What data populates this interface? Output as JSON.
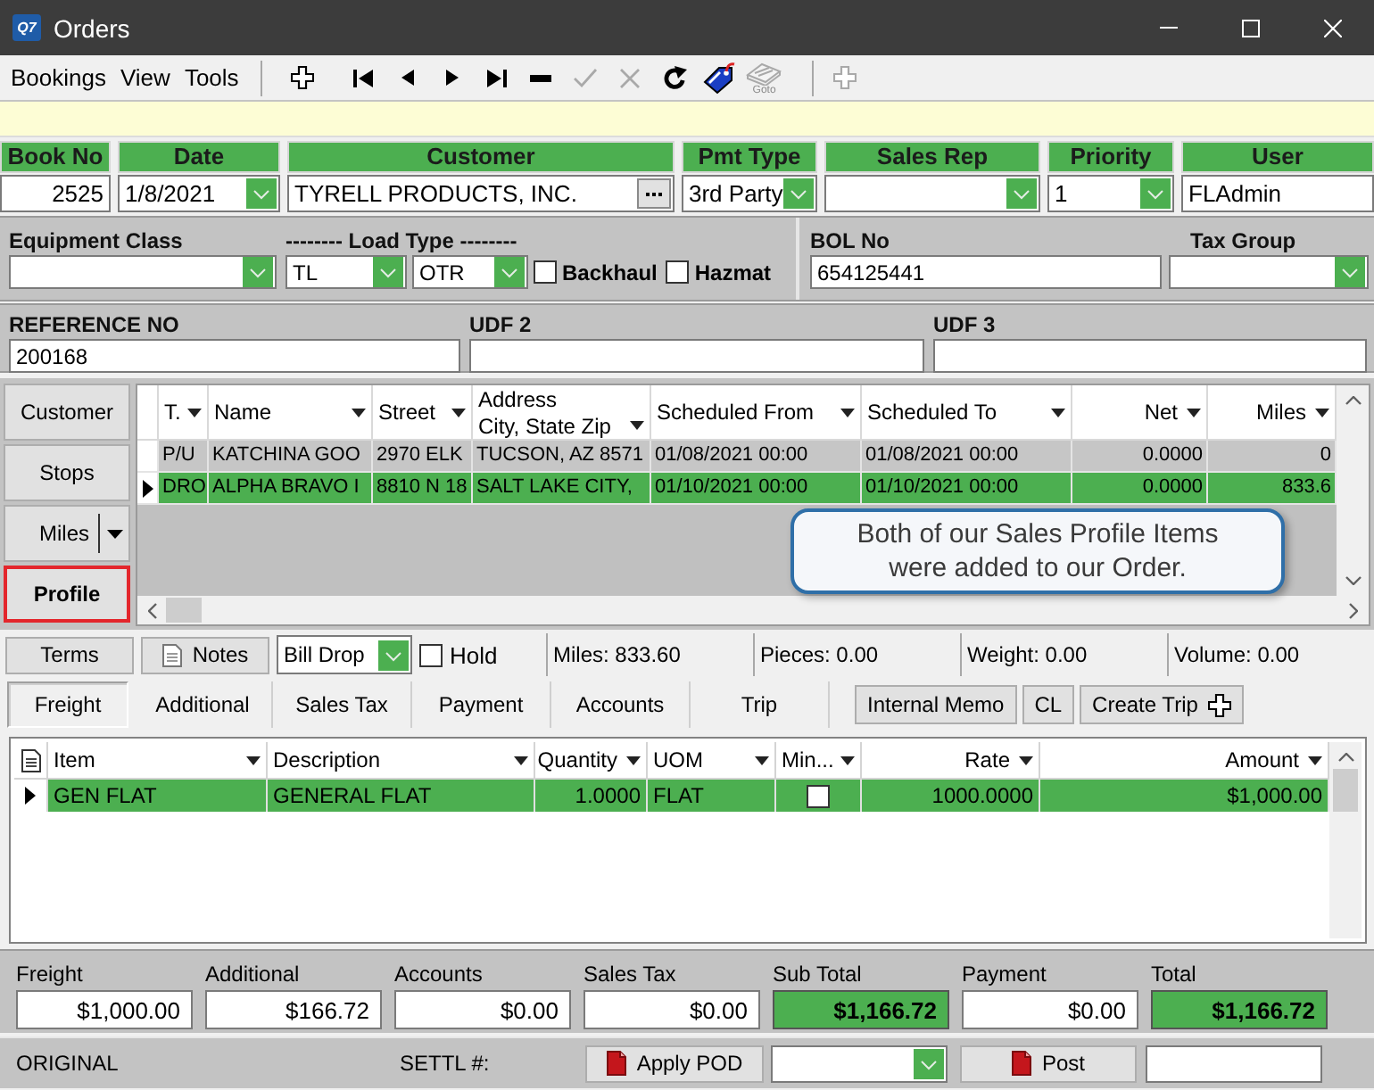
{
  "window": {
    "logo": "Q7",
    "title": "Orders"
  },
  "menu": [
    {
      "label": "Bookings"
    },
    {
      "label": "View"
    },
    {
      "label": "Tools"
    }
  ],
  "toolbar": [
    {
      "buttons": [
        {
          "kind": "add",
          "disabled": false
        },
        {
          "kind": "first",
          "disabled": false
        },
        {
          "kind": "previous",
          "disabled": false
        },
        {
          "kind": "next",
          "disabled": false
        },
        {
          "kind": "last",
          "disabled": false
        },
        {
          "kind": "delete",
          "disabled": false
        },
        {
          "kind": "save",
          "disabled": true
        },
        {
          "kind": "cancel",
          "disabled": true
        },
        {
          "kind": "refresh",
          "disabled": false
        },
        {
          "kind": "tag",
          "disabled": false
        },
        {
          "kind": "goto",
          "label": "Goto",
          "disabled": true
        }
      ]
    },
    {
      "buttons": [
        {
          "kind": "add",
          "disabled": true
        }
      ]
    }
  ],
  "header": [
    {
      "label": "Book No",
      "kind": "number",
      "value": "2525"
    },
    {
      "label": "Date",
      "kind": "dropdown",
      "value": "1/8/2021"
    },
    {
      "label": "Customer",
      "kind": "lookup",
      "value": "TYRELL PRODUCTS, INC."
    },
    {
      "label": "Pmt Type",
      "kind": "dropdown",
      "value": "3rd Party"
    },
    {
      "label": "Sales Rep",
      "kind": "dropdown"
    },
    {
      "label": "Priority",
      "kind": "dropdown",
      "value": "1"
    },
    {
      "label": "User",
      "kind": "text",
      "value": "FLAdmin"
    }
  ],
  "equipment": {
    "equipment_class": {
      "label": "Equipment Class"
    },
    "load_type": {
      "label": "-------- Load Type --------",
      "values": [
        "TL",
        "OTR"
      ]
    },
    "options": [
      {
        "label": "Backhaul",
        "checked": false
      },
      {
        "label": "Hazmat",
        "checked": false
      }
    ],
    "bol_no": {
      "label": "BOL No",
      "value": "654125441"
    },
    "tax_group": {
      "label": "Tax Group"
    }
  },
  "reference": [
    {
      "label": "REFERENCE NO",
      "value": "200168"
    },
    {
      "label": "UDF 2"
    },
    {
      "label": "UDF 3"
    }
  ],
  "side_buttons": [
    {
      "label": "Customer",
      "highlighted": false,
      "split": false
    },
    {
      "label": "Stops",
      "highlighted": false,
      "split": false
    },
    {
      "label": "Miles",
      "highlighted": false,
      "split": true
    },
    {
      "label": "Profile",
      "highlighted": true,
      "split": false
    }
  ],
  "stops": {
    "columns": [
      {
        "label": "T.",
        "kind": "text"
      },
      {
        "label": "Name",
        "kind": "text"
      },
      {
        "label": "Street",
        "kind": "text"
      },
      {
        "label": "City, State Zip",
        "group": "Address",
        "kind": "text"
      },
      {
        "label": "Scheduled From",
        "kind": "text"
      },
      {
        "label": "Scheduled To",
        "kind": "text"
      },
      {
        "label": "Net",
        "kind": "number"
      },
      {
        "label": "Miles",
        "kind": "number"
      }
    ],
    "rows": [
      {
        "selected": false,
        "cells": [
          "P/U",
          "KATCHINA GOO",
          "2970 ELK",
          "TUCSON, AZ 8571",
          "01/08/2021 00:00",
          "01/08/2021 00:00",
          "0.0000",
          "0"
        ]
      },
      {
        "selected": true,
        "cells": [
          "DRO",
          "ALPHA BRAVO I",
          "8810 N 18",
          "SALT LAKE CITY,",
          "01/10/2021 00:00",
          "01/10/2021 00:00",
          "0.0000",
          "833.6"
        ]
      }
    ]
  },
  "callout": {
    "text": "Both of our Sales Profile Items were added to our Order."
  },
  "info_bar": {
    "buttons": [
      {
        "label": "Terms",
        "kind": "plain"
      },
      {
        "label": "Notes",
        "kind": "note"
      }
    ],
    "bill_type": {
      "value": "Bill Drop"
    },
    "hold": {
      "label": "Hold",
      "checked": false
    },
    "stats": [
      "Miles: 833.60",
      "Pieces: 0.00",
      "Weight: 0.00",
      "Volume: 0.00"
    ]
  },
  "tabs": [
    {
      "label": "Freight",
      "selected": true
    },
    {
      "label": "Additional",
      "selected": false
    },
    {
      "label": "Sales Tax",
      "selected": false
    },
    {
      "label": "Payment",
      "selected": false
    },
    {
      "label": "Accounts",
      "selected": false
    },
    {
      "label": "Trip",
      "selected": false
    }
  ],
  "tab_buttons": [
    {
      "label": "Internal Memo",
      "kind": "plain"
    },
    {
      "label": "CL",
      "kind": "plain"
    },
    {
      "label": "Create Trip",
      "kind": "add"
    }
  ],
  "items": {
    "columns": [
      {
        "label": "Item",
        "kind": "text"
      },
      {
        "label": "Description",
        "kind": "text"
      },
      {
        "label": "Quantity",
        "kind": "number"
      },
      {
        "label": "UOM",
        "kind": "text"
      },
      {
        "label": "Min...",
        "kind": "check"
      },
      {
        "label": "Rate",
        "kind": "number"
      },
      {
        "label": "Amount",
        "kind": "number"
      }
    ],
    "rows": [
      {
        "selected": true,
        "cells": [
          "GEN FLAT",
          "GENERAL FLAT",
          "1.0000",
          "FLAT",
          {
            "checked": false
          },
          "1000.0000",
          "$1,000.00"
        ]
      }
    ]
  },
  "totals": [
    {
      "label": "Freight",
      "value": "$1,000.00",
      "emphasized": false
    },
    {
      "label": "Additional",
      "value": "$166.72",
      "emphasized": false
    },
    {
      "label": "Accounts",
      "value": "$0.00",
      "emphasized": false
    },
    {
      "label": "Sales Tax",
      "value": "$0.00",
      "emphasized": false
    },
    {
      "label": "Sub Total",
      "value": "$1,166.72",
      "emphasized": true
    },
    {
      "label": "Payment",
      "value": "$0.00",
      "emphasized": false
    },
    {
      "label": "Total",
      "value": "$1,166.72",
      "emphasized": true
    }
  ],
  "status_bar": {
    "state": "ORIGINAL",
    "settlement_label": "SETTL #:",
    "buttons": [
      {
        "label": "Apply POD"
      },
      {
        "label": "Post"
      }
    ]
  }
}
